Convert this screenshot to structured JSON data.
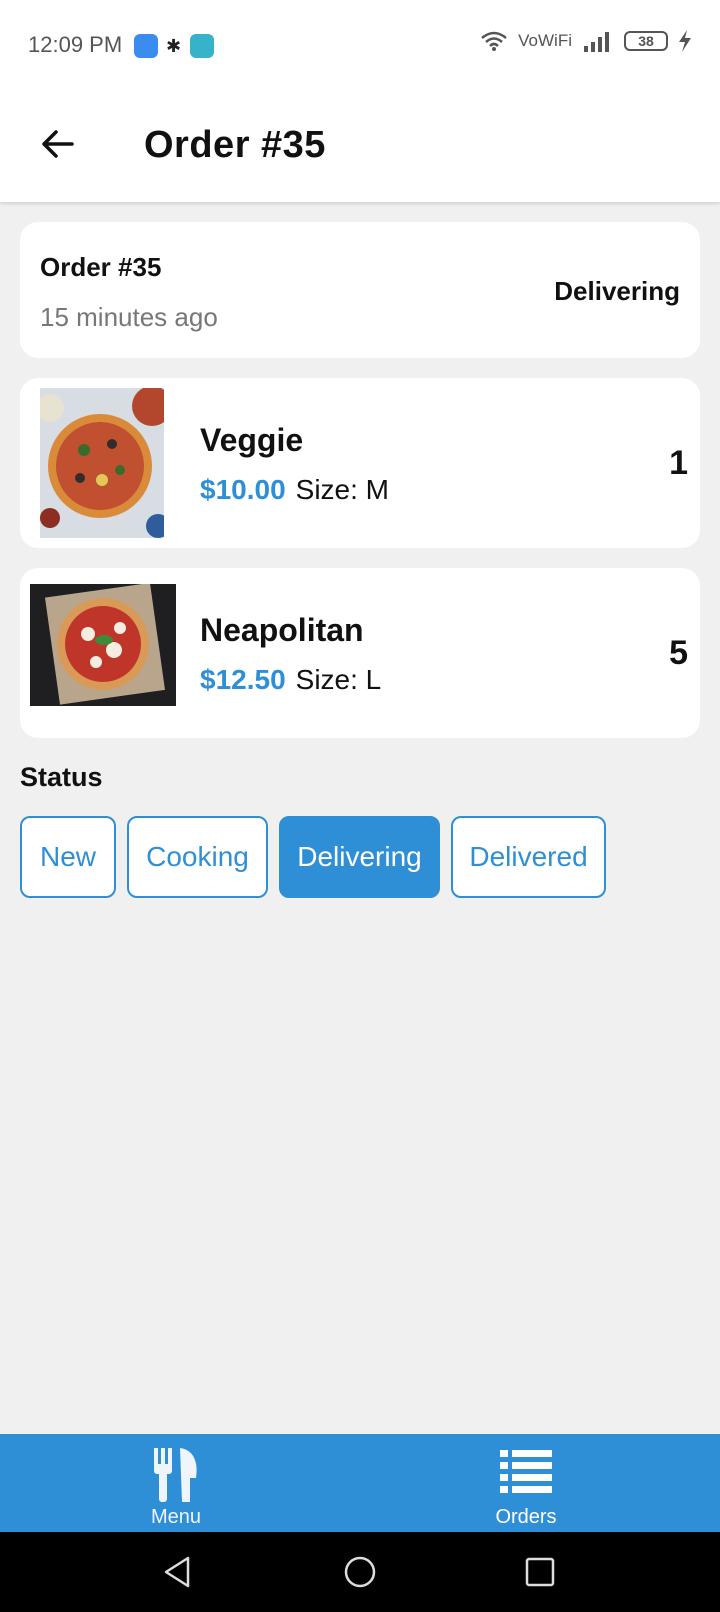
{
  "status_bar": {
    "time": "12:09 PM",
    "network": "VoWiFi",
    "battery": "38",
    "icons": [
      "settings-app-icon",
      "bluetooth-icon",
      "usb-icon",
      "wifi-icon",
      "signal-icon",
      "battery-icon",
      "charging-icon"
    ]
  },
  "app_bar": {
    "back_icon": "arrow-left-icon",
    "title": "Order #35"
  },
  "order_summary": {
    "title": "Order #35",
    "time_ago": "15 minutes ago",
    "status": "Delivering"
  },
  "items": [
    {
      "name": "Veggie",
      "price": "$10.00",
      "size": "Size: M",
      "quantity": "1",
      "image": "veggie-pizza-photo"
    },
    {
      "name": "Neapolitan",
      "price": "$12.50",
      "size": "Size: L",
      "quantity": "5",
      "image": "neapolitan-pizza-photo"
    }
  ],
  "status_section": {
    "label": "Status",
    "options": [
      "New",
      "Cooking",
      "Delivering",
      "Delivered"
    ],
    "selected": "Delivering"
  },
  "bottom_nav": {
    "items": [
      {
        "label": "Menu",
        "icon": "fork-knife-icon"
      },
      {
        "label": "Orders",
        "icon": "list-icon"
      }
    ]
  },
  "colors": {
    "accent": "#2f8fd6",
    "background": "#f0f0f0",
    "card": "#ffffff"
  }
}
